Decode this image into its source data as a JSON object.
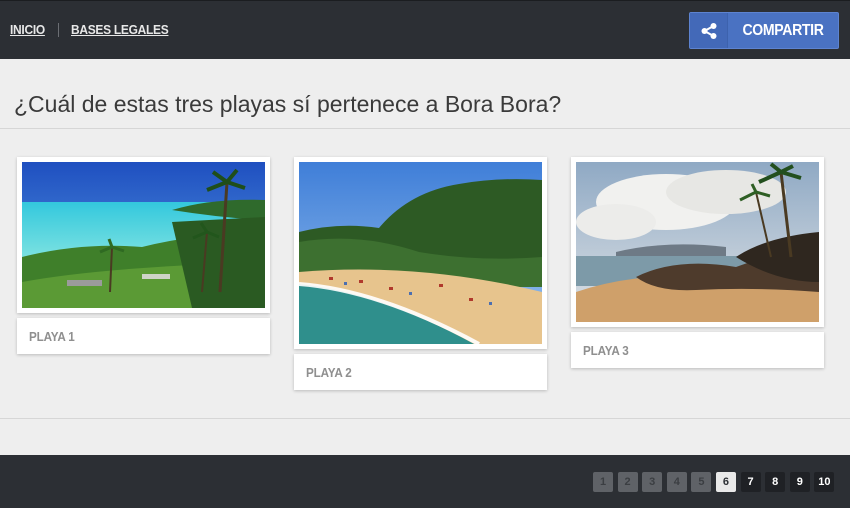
{
  "nav": {
    "home": "INICIO",
    "legal": "BASES LEGALES"
  },
  "share": {
    "label": "COMPARTIR",
    "icon": "share-icon",
    "color": "#4a72c2"
  },
  "question": "¿Cuál de estas tres playas sí pertenece a Bora Bora?",
  "options": [
    {
      "label": "PLAYA 1",
      "image": "tropical-lagoon-photo"
    },
    {
      "label": "PLAYA 2",
      "image": "sandy-beach-photo"
    },
    {
      "label": "PLAYA 3",
      "image": "rocky-coast-photo"
    }
  ],
  "pagination": {
    "pages": [
      "1",
      "2",
      "3",
      "4",
      "5",
      "6",
      "7",
      "8",
      "9",
      "10"
    ],
    "current": "6"
  },
  "colors": {
    "bar": "#2c2f34",
    "background": "#eeeeee"
  }
}
